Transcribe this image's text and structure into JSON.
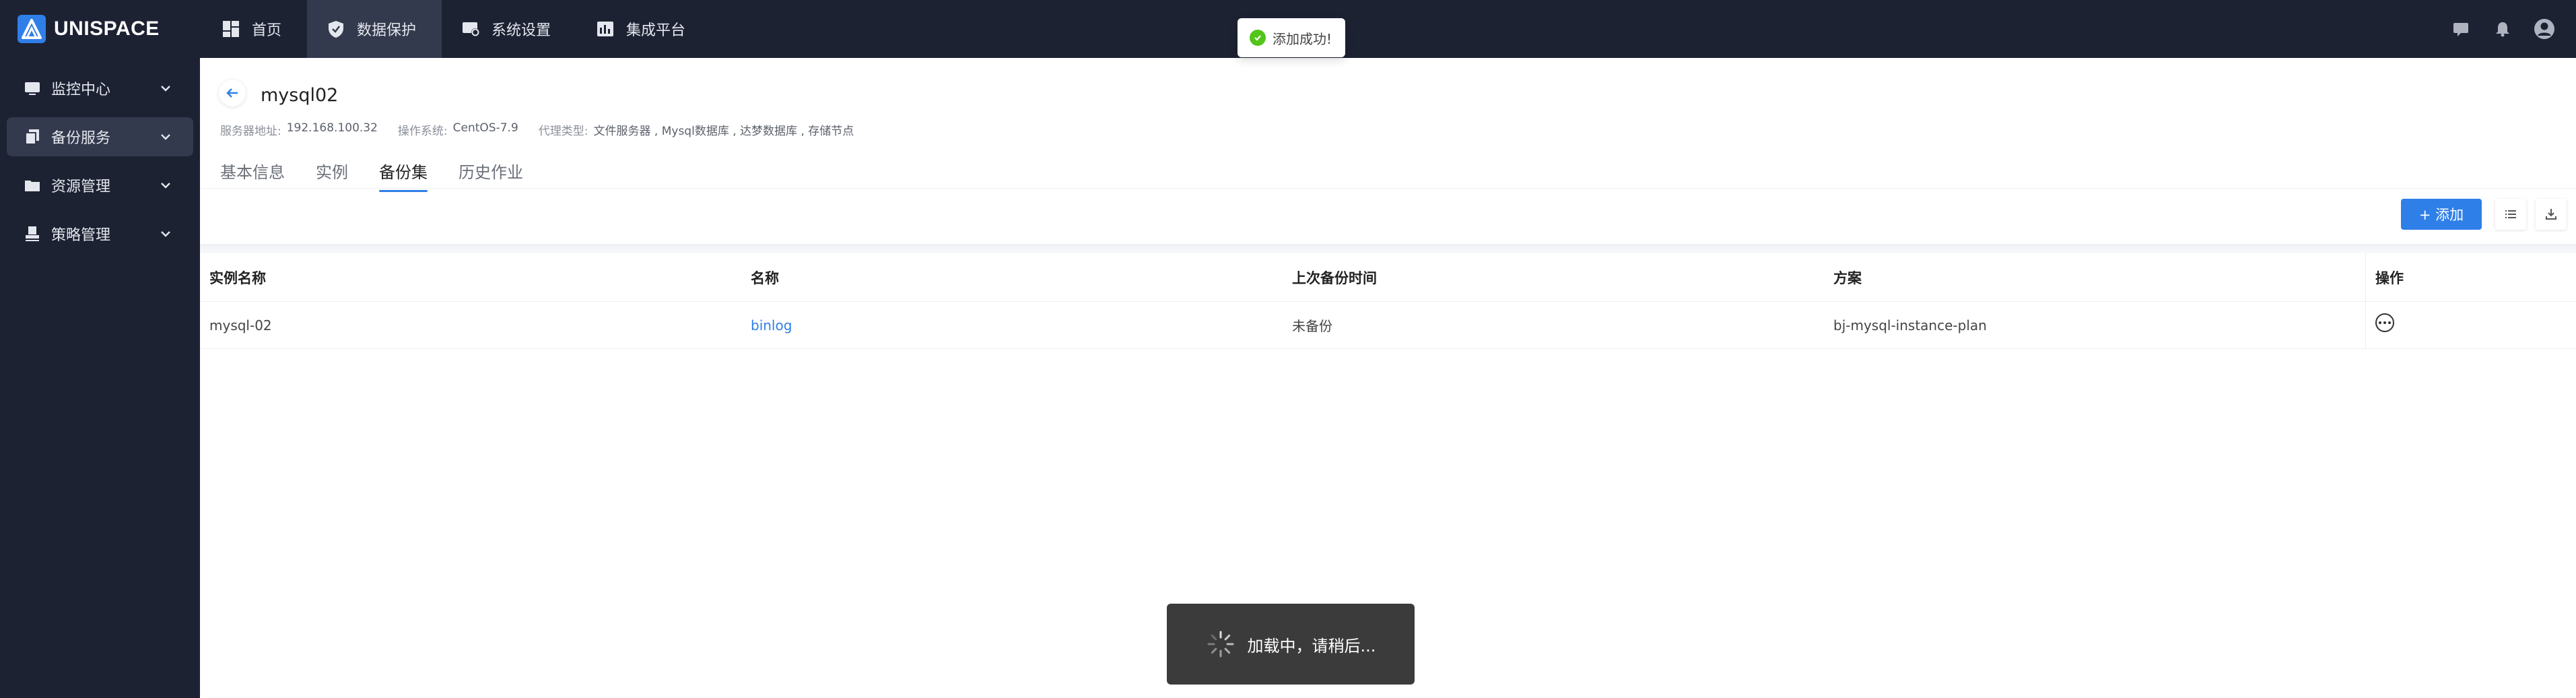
{
  "app": {
    "name": "UNISPACE"
  },
  "topnav": [
    {
      "label": "首页",
      "icon": "dashboard-icon",
      "active": false
    },
    {
      "label": "数据保护",
      "icon": "shield-icon",
      "active": true
    },
    {
      "label": "系统设置",
      "icon": "settings-icon",
      "active": false
    },
    {
      "label": "集成平台",
      "icon": "chart-icon",
      "active": false
    }
  ],
  "sidebar": {
    "items": [
      {
        "label": "监控中心",
        "icon": "monitor-icon",
        "active": false
      },
      {
        "label": "备份服务",
        "icon": "copy-icon",
        "active": true
      },
      {
        "label": "资源管理",
        "icon": "folder-icon",
        "active": false
      },
      {
        "label": "策略管理",
        "icon": "stamp-icon",
        "active": false
      }
    ]
  },
  "page": {
    "title": "mysql02",
    "meta": [
      {
        "key": "服务器地址:",
        "value": "192.168.100.32"
      },
      {
        "key": "操作系统:",
        "value": "CentOS-7.9"
      },
      {
        "key": "代理类型:",
        "value": "文件服务器 , Mysql数据库 , 达梦数据库 , 存储节点"
      }
    ],
    "tabs": [
      "基本信息",
      "实例",
      "备份集",
      "历史作业"
    ],
    "active_tab": 2
  },
  "toolbar": {
    "add_label": "+ 添加"
  },
  "table": {
    "columns": [
      "实例名称",
      "名称",
      "上次备份时间",
      "方案",
      "操作"
    ],
    "rows": [
      {
        "instance": "mysql-02",
        "name": "binlog",
        "last_backup": "未备份",
        "plan": "bj-mysql-instance-plan"
      }
    ]
  },
  "toast": {
    "text": "添加成功!"
  },
  "loading": {
    "text": "加载中，请稍后..."
  },
  "colors": {
    "primary": "#2f7fe8",
    "sidebar": "#1d2233",
    "success": "#52c41a"
  }
}
